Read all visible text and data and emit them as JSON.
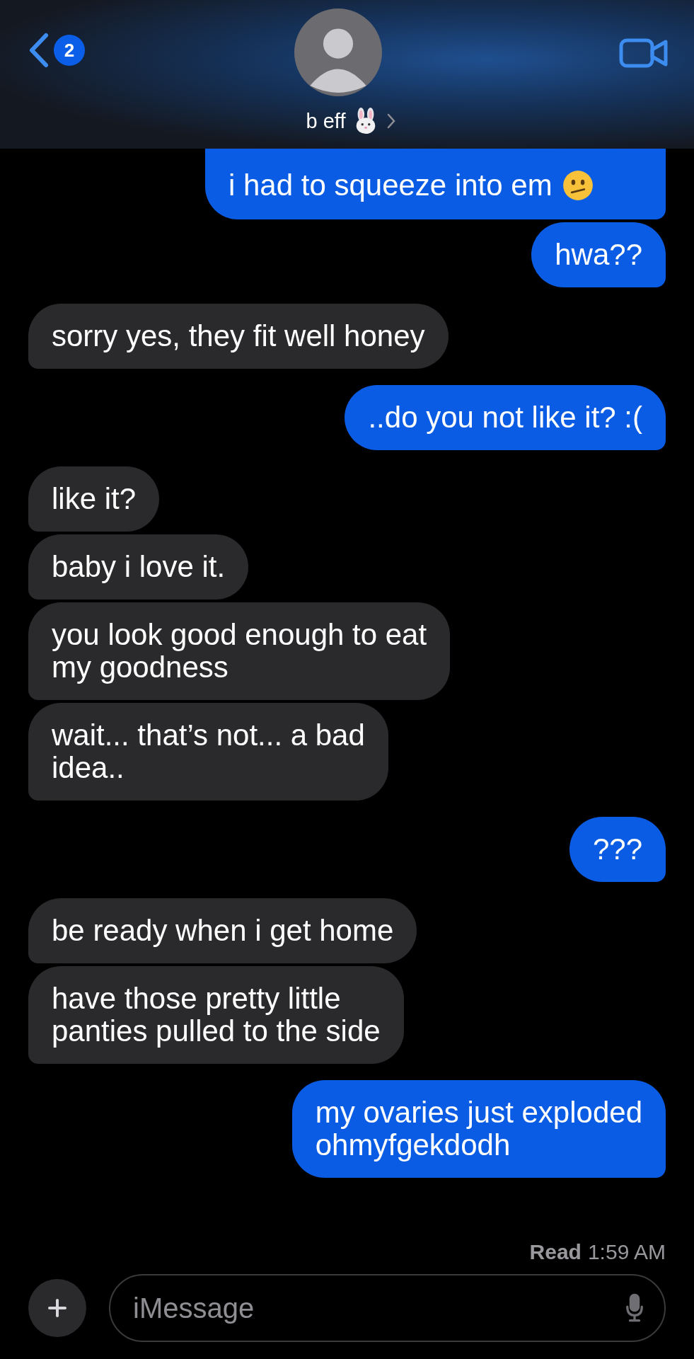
{
  "header": {
    "back_badge": "2",
    "contact_name": "b eff"
  },
  "messages": [
    {
      "kind": "sent",
      "text": "i had to squeeze into em",
      "cut_top": true,
      "has_emoji": true
    },
    {
      "kind": "sent",
      "text": "hwa??"
    },
    {
      "kind": "received",
      "text": "sorry yes, they fit well honey"
    },
    {
      "kind": "sent",
      "text": "..do you not like it? :("
    },
    {
      "kind": "received",
      "text": "like it?"
    },
    {
      "kind": "received",
      "text": "baby i love it."
    },
    {
      "kind": "received",
      "text": "you look good enough to eat\nmy goodness"
    },
    {
      "kind": "received",
      "text": "wait... that’s not... a bad\nidea.."
    },
    {
      "kind": "sent",
      "text": "???"
    },
    {
      "kind": "received",
      "text": "be ready when i get home"
    },
    {
      "kind": "received",
      "text": "have those pretty little\npanties pulled to the side"
    },
    {
      "kind": "sent",
      "text": "my ovaries just exploded\nohmyfgekdodh"
    }
  ],
  "status": {
    "label": "Read",
    "time": "1:59 AM"
  },
  "composer": {
    "placeholder": "iMessage"
  }
}
